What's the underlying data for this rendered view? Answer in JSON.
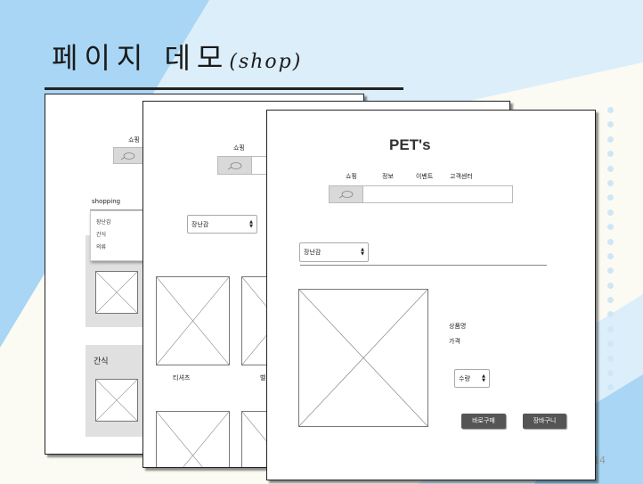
{
  "slide": {
    "title": "페이지 데모",
    "title_sub": "(shop)",
    "page_number": "14"
  },
  "frame1": {
    "menu_label": "쇼핑",
    "search_value": "shopping",
    "dropdown_items": [
      "장난감",
      "간식",
      "의류"
    ],
    "section_label": "간식"
  },
  "frame2": {
    "menu_label": "쇼핑",
    "category_select": "장난감",
    "product_label": "티셔츠",
    "product_label_2": "벨"
  },
  "frame3": {
    "brand": "PET's",
    "nav": [
      "쇼핑",
      "정보",
      "이벤트",
      "고객센터"
    ],
    "category_select": "장난감",
    "product_name_label": "상품명",
    "price_label": "가격",
    "quantity_select": "수량",
    "buy_now_button": "바로구매",
    "cart_button": "장바구니"
  },
  "colors": {
    "bg_light_blue": "#dceefa",
    "bg_blue": "#a9d6f4",
    "button_dark": "#555555"
  }
}
